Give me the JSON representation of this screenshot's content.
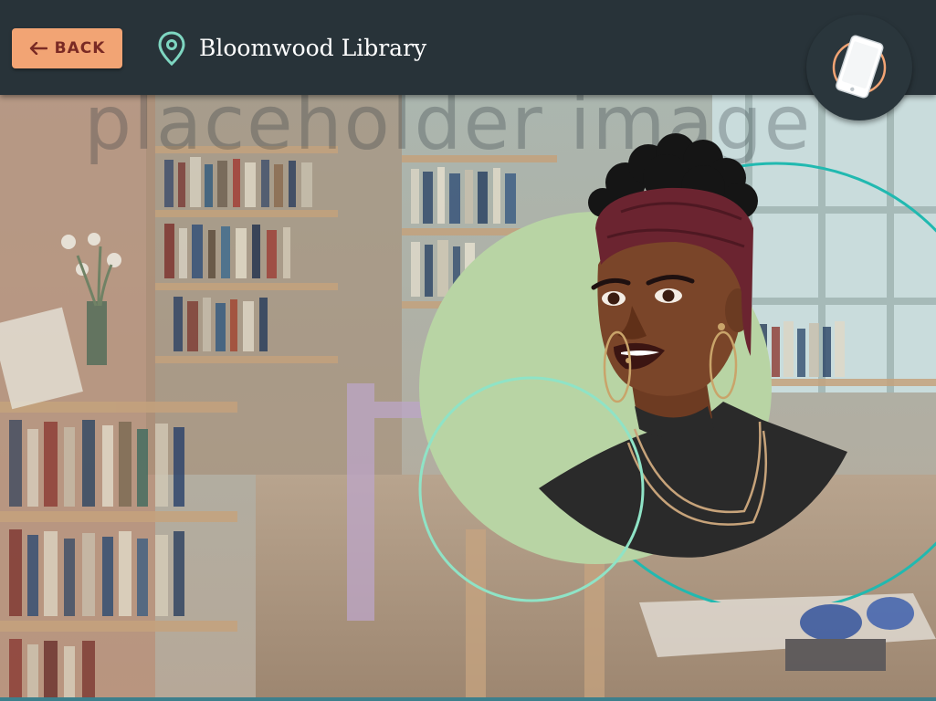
{
  "header": {
    "back_label": "BACK",
    "location": "Bloomwood Library"
  },
  "background": {
    "watermark": "placeholder image"
  },
  "icons": {
    "back": "arrow-left-icon",
    "location": "map-pin-icon",
    "device": "smartphone-icon"
  },
  "colors": {
    "header_bg": "#283339",
    "back_button": "#f2a474",
    "back_text": "#7a2a24",
    "pin": "#7ed6c1",
    "portrait_circle": "#b8d4a4",
    "ring_teal": "#21b9b0",
    "ring_mint": "#8fe3c6",
    "headwrap": "#6b2430",
    "skin": "#7a4529",
    "turtleneck": "#2a2a2a"
  }
}
